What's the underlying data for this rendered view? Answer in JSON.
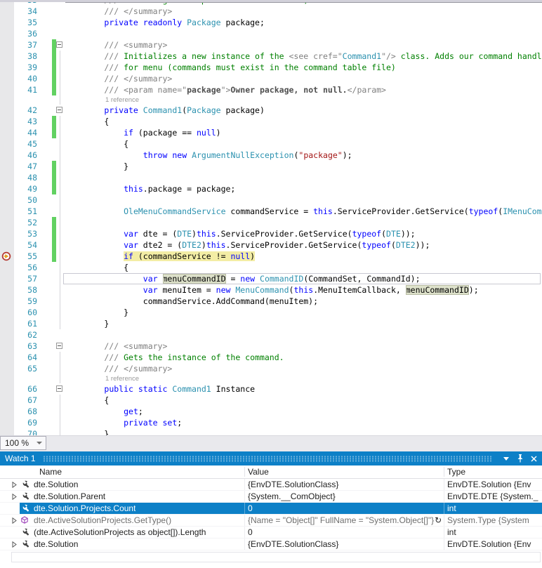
{
  "editor": {
    "zoom_label": "100 %",
    "lines": [
      {
        "n": 33,
        "partial": "top",
        "seg": [
          [
            "        /// ",
            "g"
          ],
          [
            "VS Package that provides this command, not null.",
            "c"
          ]
        ]
      },
      {
        "n": 34,
        "seg": [
          [
            "        /// </summary>",
            "g"
          ]
        ]
      },
      {
        "n": 35,
        "seg": [
          [
            "        ",
            "p"
          ],
          [
            "private readonly",
            "k"
          ],
          [
            " ",
            "p"
          ],
          [
            "Package",
            "t"
          ],
          [
            " package;",
            "p"
          ]
        ]
      },
      {
        "n": 36,
        "seg": []
      },
      {
        "n": 37,
        "bar": true,
        "fold": true,
        "seg": [
          [
            "        /// <summary>",
            "g"
          ]
        ]
      },
      {
        "n": 38,
        "bar": true,
        "guide": true,
        "seg": [
          [
            "        /// ",
            "g"
          ],
          [
            "Initializes a new instance of the ",
            "c"
          ],
          [
            "<see cref=\"",
            "g"
          ],
          [
            "Command1",
            "t"
          ],
          [
            "\"/>",
            "g"
          ],
          [
            " class. Adds our command handler",
            "c"
          ]
        ]
      },
      {
        "n": 39,
        "bar": true,
        "guide": true,
        "seg": [
          [
            "        /// ",
            "g"
          ],
          [
            "for menu (commands must exist in the command table file)",
            "c"
          ]
        ]
      },
      {
        "n": 40,
        "bar": true,
        "guide": true,
        "seg": [
          [
            "        /// </summary>",
            "g"
          ]
        ]
      },
      {
        "n": 41,
        "bar": true,
        "guide": true,
        "seg": [
          [
            "        /// <param name=\"",
            "g"
          ],
          [
            "package",
            "gb"
          ],
          [
            "\">",
            "g"
          ],
          [
            "Owner package, not null.",
            "gb"
          ],
          [
            "</param>",
            "g"
          ]
        ]
      },
      {
        "lens": "1 reference",
        "guide": true
      },
      {
        "n": 42,
        "fold": true,
        "seg": [
          [
            "        ",
            "p"
          ],
          [
            "private",
            "k"
          ],
          [
            " ",
            "p"
          ],
          [
            "Command1",
            "t"
          ],
          [
            "(",
            "p"
          ],
          [
            "Package",
            "t"
          ],
          [
            " package)",
            "p"
          ]
        ]
      },
      {
        "n": 43,
        "bar": true,
        "guide": true,
        "seg": [
          [
            "        {",
            "p"
          ]
        ]
      },
      {
        "n": 44,
        "bar": true,
        "guide": true,
        "seg": [
          [
            "            ",
            "p"
          ],
          [
            "if",
            "k"
          ],
          [
            " (package == ",
            "p"
          ],
          [
            "null",
            "k"
          ],
          [
            ")",
            "p"
          ]
        ]
      },
      {
        "n": 45,
        "guide": true,
        "seg": [
          [
            "            {",
            "p"
          ]
        ]
      },
      {
        "n": 46,
        "guide": true,
        "seg": [
          [
            "                ",
            "p"
          ],
          [
            "throw",
            "k"
          ],
          [
            " ",
            "p"
          ],
          [
            "new",
            "k"
          ],
          [
            " ",
            "p"
          ],
          [
            "ArgumentNullException",
            "t"
          ],
          [
            "(",
            "p"
          ],
          [
            "\"package\"",
            "s"
          ],
          [
            ");",
            "p"
          ]
        ]
      },
      {
        "n": 47,
        "bar": true,
        "guide": true,
        "seg": [
          [
            "            }",
            "p"
          ]
        ]
      },
      {
        "n": 48,
        "bar": true,
        "guide": true,
        "seg": []
      },
      {
        "n": 49,
        "bar": true,
        "guide": true,
        "seg": [
          [
            "            ",
            "p"
          ],
          [
            "this",
            "k"
          ],
          [
            ".package = package;",
            "p"
          ]
        ]
      },
      {
        "n": 50,
        "guide": true,
        "seg": []
      },
      {
        "n": 51,
        "guide": true,
        "seg": [
          [
            "            ",
            "p"
          ],
          [
            "OleMenuCommandService",
            "t"
          ],
          [
            " commandService = ",
            "p"
          ],
          [
            "this",
            "k"
          ],
          [
            ".ServiceProvider.GetService(",
            "p"
          ],
          [
            "typeof",
            "k"
          ],
          [
            "(",
            "p"
          ],
          [
            "IMenuCommandService",
            "t"
          ],
          [
            "))",
            "p"
          ]
        ]
      },
      {
        "n": 52,
        "bar": true,
        "guide": true,
        "seg": []
      },
      {
        "n": 53,
        "bar": true,
        "guide": true,
        "seg": [
          [
            "            ",
            "p"
          ],
          [
            "var",
            "k"
          ],
          [
            " dte = (",
            "p"
          ],
          [
            "DTE",
            "t"
          ],
          [
            ")",
            "p"
          ],
          [
            "this",
            "k"
          ],
          [
            ".ServiceProvider.GetService(",
            "p"
          ],
          [
            "typeof",
            "k"
          ],
          [
            "(",
            "p"
          ],
          [
            "DTE",
            "t"
          ],
          [
            "));",
            "p"
          ]
        ]
      },
      {
        "n": 54,
        "bar": true,
        "guide": true,
        "seg": [
          [
            "            ",
            "p"
          ],
          [
            "var",
            "k"
          ],
          [
            " dte2 = (",
            "p"
          ],
          [
            "DTE2",
            "t"
          ],
          [
            ")",
            "p"
          ],
          [
            "this",
            "k"
          ],
          [
            ".ServiceProvider.GetService(",
            "p"
          ],
          [
            "typeof",
            "k"
          ],
          [
            "(",
            "p"
          ],
          [
            "DTE2",
            "t"
          ],
          [
            "));",
            "p"
          ]
        ]
      },
      {
        "n": 55,
        "bar": true,
        "guide": true,
        "bp": true,
        "seg": [
          [
            "            ",
            "p"
          ],
          [
            "if",
            "k hl"
          ],
          [
            " (commandService != ",
            "p hl"
          ],
          [
            "null",
            "k hl"
          ],
          [
            ")",
            "p hl"
          ]
        ]
      },
      {
        "n": 56,
        "guide": true,
        "seg": [
          [
            "            {",
            "p"
          ]
        ]
      },
      {
        "n": 57,
        "guide": true,
        "box": true,
        "seg": [
          [
            "                ",
            "p"
          ],
          [
            "var",
            "k"
          ],
          [
            " ",
            "p"
          ],
          [
            "menuCommandID",
            "p ref"
          ],
          [
            " = ",
            "p"
          ],
          [
            "new",
            "k"
          ],
          [
            " ",
            "p"
          ],
          [
            "CommandID",
            "t"
          ],
          [
            "(CommandSet, CommandId);",
            "p"
          ]
        ]
      },
      {
        "n": 58,
        "guide": true,
        "seg": [
          [
            "                ",
            "p"
          ],
          [
            "var",
            "k"
          ],
          [
            " menuItem = ",
            "p"
          ],
          [
            "new",
            "k"
          ],
          [
            " ",
            "p"
          ],
          [
            "MenuCommand",
            "t"
          ],
          [
            "(",
            "p"
          ],
          [
            "this",
            "k"
          ],
          [
            ".MenuItemCallback, ",
            "p"
          ],
          [
            "menuCommandID",
            "p ref"
          ],
          [
            ");",
            "p"
          ]
        ]
      },
      {
        "n": 59,
        "guide": true,
        "seg": [
          [
            "                commandService.AddCommand(menuItem);",
            "p"
          ]
        ]
      },
      {
        "n": 60,
        "guide": true,
        "seg": [
          [
            "            }",
            "p"
          ]
        ]
      },
      {
        "n": 61,
        "guide": true,
        "seg": [
          [
            "        }",
            "p"
          ]
        ]
      },
      {
        "n": 62,
        "seg": []
      },
      {
        "n": 63,
        "fold": true,
        "seg": [
          [
            "        /// <summary>",
            "g"
          ]
        ]
      },
      {
        "n": 64,
        "guide": true,
        "seg": [
          [
            "        /// ",
            "g"
          ],
          [
            "Gets the instance of the command.",
            "c"
          ]
        ]
      },
      {
        "n": 65,
        "guide": true,
        "seg": [
          [
            "        /// </summary>",
            "g"
          ]
        ]
      },
      {
        "lens": "1 reference",
        "guide": true
      },
      {
        "n": 66,
        "fold": true,
        "seg": [
          [
            "        ",
            "p"
          ],
          [
            "public static",
            "k"
          ],
          [
            " ",
            "p"
          ],
          [
            "Command1",
            "t"
          ],
          [
            " Instance",
            "p"
          ]
        ]
      },
      {
        "n": 67,
        "guide": true,
        "seg": [
          [
            "        {",
            "p"
          ]
        ]
      },
      {
        "n": 68,
        "guide": true,
        "seg": [
          [
            "            ",
            "p"
          ],
          [
            "get",
            "k"
          ],
          [
            ";",
            "p"
          ]
        ]
      },
      {
        "n": 69,
        "guide": true,
        "seg": [
          [
            "            ",
            "p"
          ],
          [
            "private",
            "k"
          ],
          [
            " ",
            "p"
          ],
          [
            "set",
            "k"
          ],
          [
            ";",
            "p"
          ]
        ]
      },
      {
        "n": 70,
        "guide": true,
        "seg": [
          [
            "        }",
            "p"
          ]
        ]
      }
    ]
  },
  "watch": {
    "title": "Watch 1",
    "columns": [
      "Name",
      "Value",
      "Type"
    ],
    "accent_color": "#0d80c7",
    "rows": [
      {
        "expand": true,
        "icon": "wrench",
        "name": "dte.Solution",
        "value": "{EnvDTE.SolutionClass}",
        "type": "EnvDTE.Solution {Env"
      },
      {
        "expand": true,
        "icon": "wrench",
        "name": "dte.Solution.Parent",
        "value": "{System.__ComObject}",
        "type": "EnvDTE.DTE {System._"
      },
      {
        "expand": false,
        "icon": "wrench",
        "name": "dte.Solution.Projects.Count",
        "value": "0",
        "type": "int",
        "selected": true
      },
      {
        "expand": true,
        "icon": "method",
        "name": "dte.ActiveSolutionProjects.GetType()",
        "value": "{Name = \"Object[]\" FullName = \"System.Object[]\"}",
        "type": "System.Type {System",
        "stale": true,
        "refresh": true
      },
      {
        "expand": false,
        "icon": "wrench",
        "name": "(dte.ActiveSolutionProjects as object[]).Length",
        "value": "0",
        "type": "int"
      },
      {
        "expand": true,
        "icon": "wrench",
        "name": "dte.Solution",
        "value": "{EnvDTE.SolutionClass}",
        "type": "EnvDTE.Solution {Env"
      }
    ]
  }
}
